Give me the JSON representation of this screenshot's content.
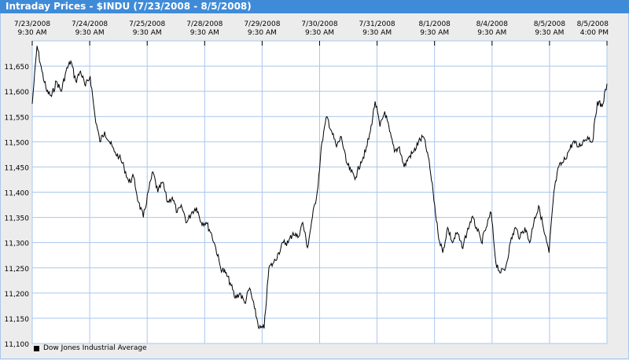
{
  "title": "Intraday Prices - $INDU (7/23/2008 - 8/5/2008)",
  "legend": {
    "label": "Dow Jones Industrial Average",
    "color": "#000000"
  },
  "chart_data": {
    "type": "line",
    "title": "Intraday Prices - $INDU (7/23/2008 - 8/5/2008)",
    "xlabel": "",
    "ylabel": "",
    "ylim": [
      11100,
      11700
    ],
    "grid": true,
    "legend_position": "bottom-left",
    "x_ticks": [
      [
        "7/23/2008",
        "9:30 AM"
      ],
      [
        "7/24/2008",
        "9:30 AM"
      ],
      [
        "7/25/2008",
        "9:30 AM"
      ],
      [
        "7/28/2008",
        "9:30 AM"
      ],
      [
        "7/29/2008",
        "9:30 AM"
      ],
      [
        "7/30/2008",
        "9:30 AM"
      ],
      [
        "7/31/2008",
        "9:30 AM"
      ],
      [
        "8/1/2008",
        "9:30 AM"
      ],
      [
        "8/4/2008",
        "9:30 AM"
      ],
      [
        "8/5/2008",
        "9:30 AM"
      ],
      [
        "8/5/2008",
        "4:00 PM"
      ]
    ],
    "y_ticks": [
      "11,100",
      "11,150",
      "11,200",
      "11,250",
      "11,300",
      "11,350",
      "11,400",
      "11,450",
      "11,500",
      "11,550",
      "11,600",
      "11,650"
    ],
    "y_tick_values": [
      11100,
      11150,
      11200,
      11250,
      11300,
      11350,
      11400,
      11450,
      11500,
      11550,
      11600,
      11650
    ],
    "series": [
      {
        "name": "Dow Jones Industrial Average",
        "color": "#000000",
        "values": [
          11575,
          11690,
          11640,
          11600,
          11590,
          11620,
          11600,
          11640,
          11660,
          11620,
          11640,
          11610,
          11630,
          11550,
          11500,
          11520,
          11500,
          11480,
          11470,
          11450,
          11420,
          11430,
          11380,
          11350,
          11400,
          11440,
          11400,
          11420,
          11380,
          11390,
          11360,
          11370,
          11340,
          11360,
          11370,
          11340,
          11340,
          11320,
          11290,
          11250,
          11240,
          11220,
          11190,
          11200,
          11180,
          11210,
          11170,
          11130,
          11130,
          11250,
          11260,
          11280,
          11300,
          11300,
          11320,
          11310,
          11340,
          11290,
          11350,
          11400,
          11500,
          11550,
          11520,
          11490,
          11510,
          11460,
          11440,
          11430,
          11460,
          11480,
          11520,
          11580,
          11530,
          11560,
          11520,
          11480,
          11490,
          11450,
          11470,
          11480,
          11500,
          11510,
          11470,
          11400,
          11320,
          11280,
          11330,
          11300,
          11320,
          11290,
          11320,
          11350,
          11330,
          11300,
          11330,
          11360,
          11260,
          11240,
          11250,
          11300,
          11330,
          11310,
          11330,
          11300,
          11350,
          11370,
          11320,
          11280,
          11400,
          11450,
          11460,
          11480,
          11500,
          11490,
          11500,
          11510,
          11500,
          11580,
          11570,
          11615
        ]
      }
    ]
  }
}
